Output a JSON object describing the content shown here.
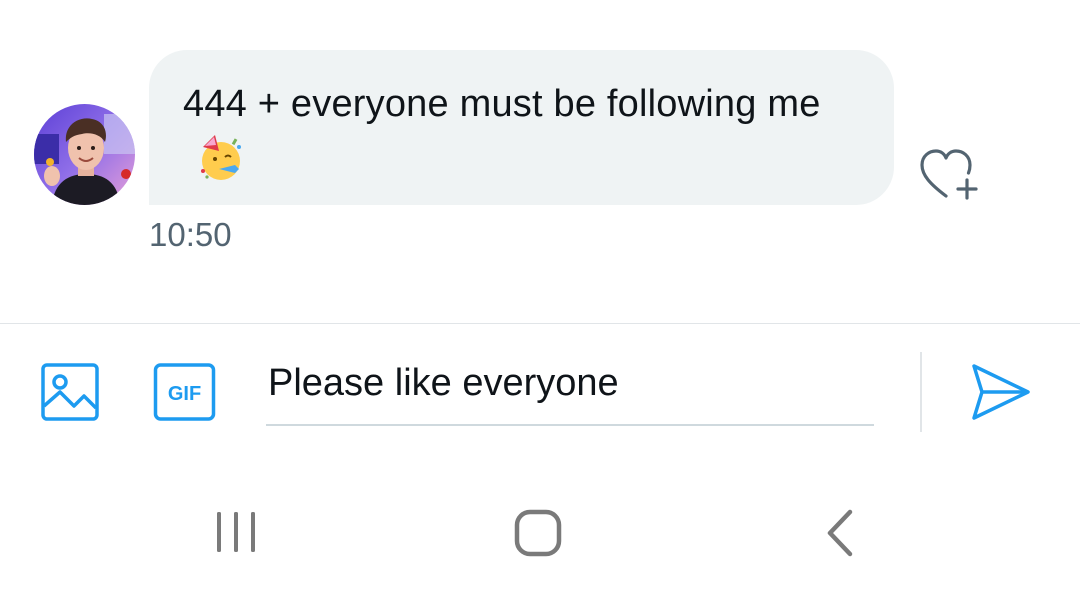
{
  "conversation": {
    "messages": [
      {
        "text": "444 + everyone must be following me",
        "emoji": "partying-face-emoji",
        "time": "10:50",
        "reaction_icon": "heart-plus-icon"
      }
    ]
  },
  "composer": {
    "value": "Please like everyone",
    "gif_label": "GIF",
    "media_icon": "image-icon",
    "send_icon": "send-icon"
  },
  "system_nav": {
    "recents_icon": "recents-icon",
    "home_icon": "home-icon",
    "back_icon": "back-icon"
  },
  "colors": {
    "accent": "#1d9bf0",
    "bubble_bg": "#eff3f4",
    "text_primary": "#0f1419",
    "text_secondary": "#536471",
    "nav_icon": "#7a7a7a"
  }
}
